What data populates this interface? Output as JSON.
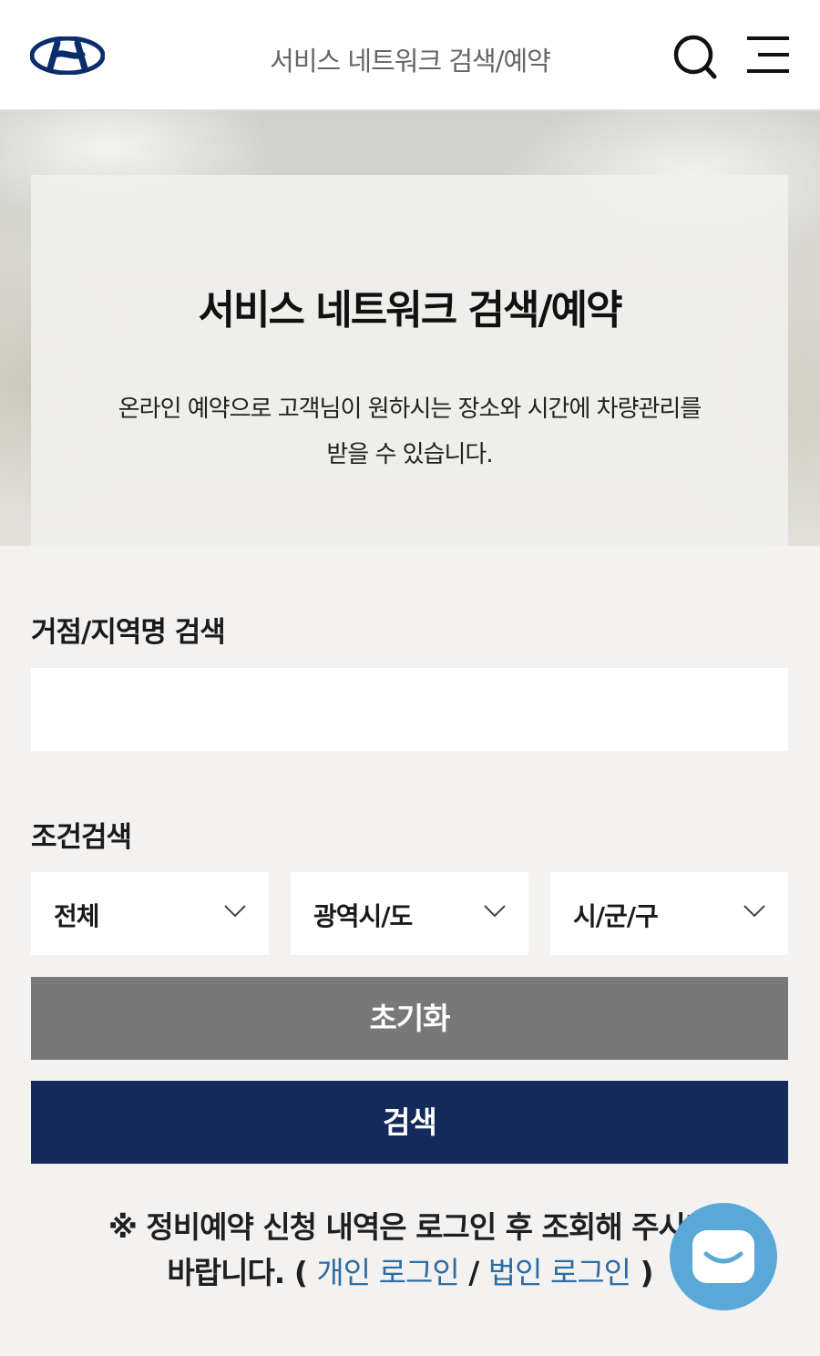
{
  "header": {
    "title": "서비스 네트워크 검색/예약",
    "logo_icon": "hyundai-logo",
    "search_icon": "search-icon",
    "menu_icon": "hamburger-menu-icon"
  },
  "hero": {
    "title": "서비스 네트워크 검색/예약",
    "description_line1": "온라인 예약으로 고객님이 원하시는 장소와 시간에 차량관리를",
    "description_line2": "받을 수 있습니다."
  },
  "keyword_search": {
    "label": "거점/지역명 검색",
    "value": "",
    "placeholder": ""
  },
  "condition_search": {
    "label": "조건검색",
    "selects": [
      {
        "selected": "전체"
      },
      {
        "selected": "광역시/도"
      },
      {
        "selected": "시/군/구"
      }
    ]
  },
  "buttons": {
    "reset_label": "초기화",
    "search_label": "검색"
  },
  "notice": {
    "text_part1": "※ 정비예약 신청 내역은 로그인 후 조회해 주시기",
    "text_part2": "바랍니다. (",
    "personal_login": "개인 로그인",
    "separator": " / ",
    "corporate_login": "법인 로그인",
    "text_end": " )"
  },
  "colors": {
    "primary_navy": "#132a5a",
    "reset_gray": "#787878",
    "link_blue": "#2d6ca2",
    "chat_blue": "#59a8d8"
  }
}
